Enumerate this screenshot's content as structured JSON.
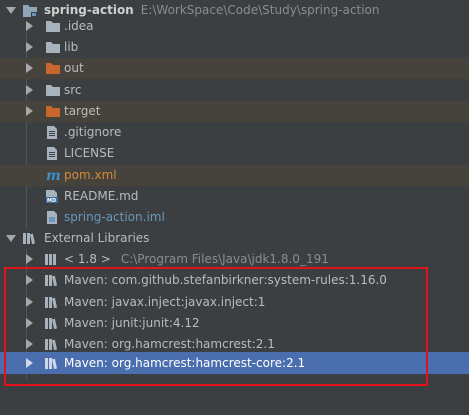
{
  "project": {
    "name": "spring-action",
    "path": "E:\\WorkSpace\\Code\\Study\\spring-action",
    "children": [
      {
        "label": ".idea",
        "kind": "folder"
      },
      {
        "label": "lib",
        "kind": "folder"
      },
      {
        "label": "out",
        "kind": "excluded-folder"
      },
      {
        "label": "src",
        "kind": "folder"
      },
      {
        "label": "target",
        "kind": "excluded-folder"
      },
      {
        "label": ".gitignore",
        "kind": "text-file"
      },
      {
        "label": "LICENSE",
        "kind": "text-file"
      },
      {
        "label": "pom.xml",
        "kind": "maven-file"
      },
      {
        "label": "README.md",
        "kind": "markdown-file"
      },
      {
        "label": "spring-action.iml",
        "kind": "module-file"
      }
    ]
  },
  "external_libraries": {
    "label": "External Libraries",
    "sdk": {
      "name": "< 1.8 >",
      "path": "C:\\Program Files\\Java\\jdk1.8.0_191"
    },
    "libraries": [
      "Maven: com.github.stefanbirkner:system-rules:1.16.0",
      "Maven: javax.inject:javax.inject:1",
      "Maven: junit:junit:4.12",
      "Maven: org.hamcrest:hamcrest:2.1",
      "Maven: org.hamcrest:hamcrest-core:2.1"
    ],
    "selected_index": 4
  },
  "colors": {
    "background": "#3c3f41",
    "selection": "#4b6eaf",
    "highlight_box": "#e0131e",
    "excluded_text": "#d48b3d",
    "module_text": "#6897bb"
  }
}
